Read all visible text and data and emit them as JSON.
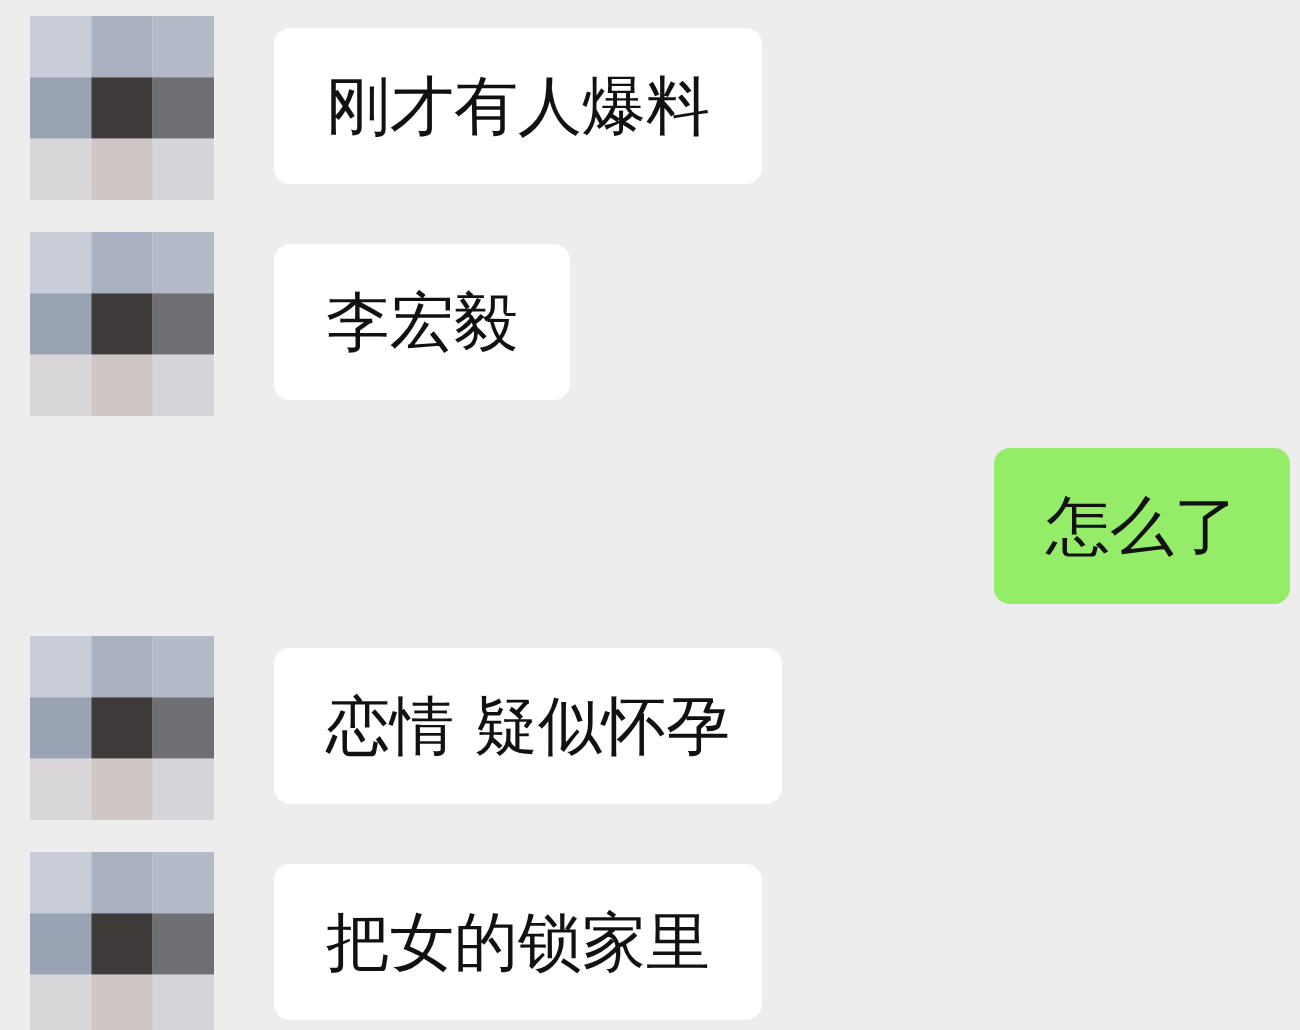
{
  "messages": [
    {
      "kind": "received",
      "text": "刚才有人爆料"
    },
    {
      "kind": "received",
      "text": "李宏毅"
    },
    {
      "kind": "sent",
      "text": "怎么了"
    },
    {
      "kind": "received",
      "text": "恋情 疑似怀孕"
    },
    {
      "kind": "received",
      "text": "把女的锁家里"
    }
  ]
}
